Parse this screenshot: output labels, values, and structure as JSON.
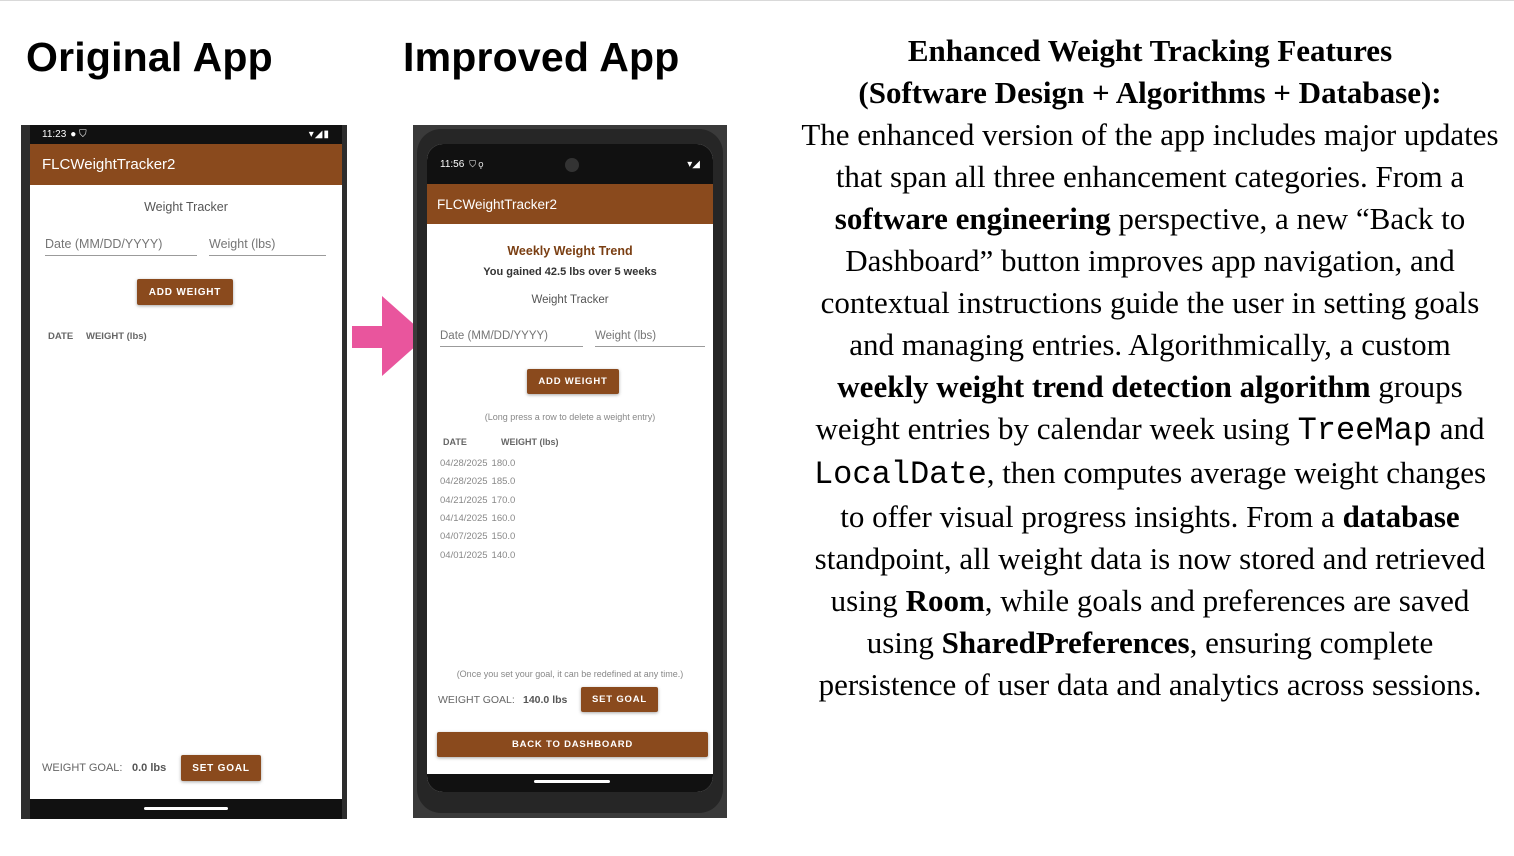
{
  "titles": {
    "original": "Original App",
    "improved": "Improved App"
  },
  "original_app": {
    "status_time": "11:23",
    "status_icons_left": "● ⛉",
    "status_icons_right": "▾◢▮",
    "app_title": "FLCWeightTracker2",
    "section_label": "Weight Tracker",
    "date_placeholder": "Date (MM/DD/YYYY)",
    "weight_placeholder": "Weight (lbs)",
    "add_button": "ADD WEIGHT",
    "table_headers": {
      "date": "DATE",
      "weight": "WEIGHT (lbs)"
    },
    "goal_label": "WEIGHT GOAL:",
    "goal_value": "0.0 lbs",
    "set_goal_button": "SET GOAL"
  },
  "improved_app": {
    "status_time": "11:56",
    "status_icons_left": "⛉ ⚲",
    "status_icons_right": "▾◢",
    "app_title": "FLCWeightTracker2",
    "trend_title": "Weekly Weight Trend",
    "trend_summary": "You gained 42.5 lbs over 5 weeks",
    "section_label": "Weight Tracker",
    "date_placeholder": "Date (MM/DD/YYYY)",
    "weight_placeholder": "Weight (lbs)",
    "add_button": "ADD WEIGHT",
    "delete_hint": "(Long press a row to delete a weight entry)",
    "table_headers": {
      "date": "DATE",
      "weight": "WEIGHT (lbs)"
    },
    "rows": [
      {
        "date": "04/28/2025",
        "weight": "180.0"
      },
      {
        "date": "04/28/2025",
        "weight": "185.0"
      },
      {
        "date": "04/21/2025",
        "weight": "170.0"
      },
      {
        "date": "04/14/2025",
        "weight": "160.0"
      },
      {
        "date": "04/07/2025",
        "weight": "150.0"
      },
      {
        "date": "04/01/2025",
        "weight": "140.0"
      }
    ],
    "goal_hint": "(Once you set your goal, it can be redefined at any time.)",
    "goal_label": "WEIGHT GOAL:",
    "goal_value": "140.0 lbs",
    "set_goal_button": "SET GOAL",
    "dashboard_button": "BACK TO DASHBOARD"
  },
  "description": {
    "heading_line1": "Enhanced Weight Tracking Features",
    "heading_line2": "(Software Design + Algorithms + Database):",
    "p1": "The enhanced version of the app includes major updates that span all three enhancement categories. From a ",
    "b1": "software engineering",
    "p2": " perspective, a new “Back to Dashboard” button improves app navigation, and contextual instructions guide the user in setting goals and managing entries. Algorithmically, a custom ",
    "b2": "weekly weight trend detection algorithm",
    "p3": " groups weight entries by calendar week using ",
    "code1": "TreeMap",
    "p4": " and ",
    "code2": "LocalDate",
    "p5": ", then computes average weight changes to offer visual progress insights. From a ",
    "b3": "database",
    "p6": " standpoint, all weight data is now stored and retrieved using ",
    "b4": "Room",
    "p7": ", while goals and preferences are saved using ",
    "b5": "SharedPreferences",
    "p8": ", ensuring complete persistence of user data and analytics across sessions."
  },
  "colors": {
    "brand_brown": "#8a4a1d",
    "arrow_pink": "#e9559d"
  },
  "icons": {
    "arrow": "right-arrow-icon"
  }
}
